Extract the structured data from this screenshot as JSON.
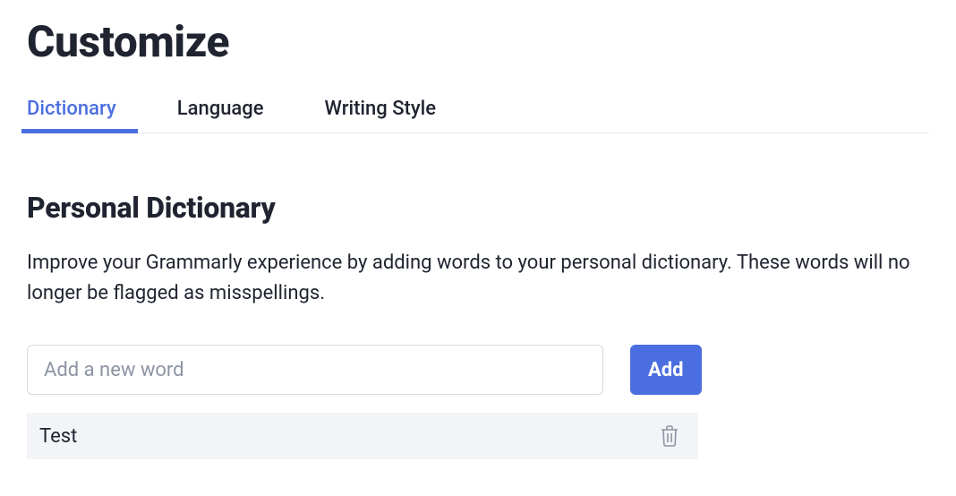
{
  "page": {
    "title": "Customize"
  },
  "tabs": [
    {
      "label": "Dictionary",
      "active": true
    },
    {
      "label": "Language",
      "active": false
    },
    {
      "label": "Writing Style",
      "active": false
    }
  ],
  "section": {
    "title": "Personal Dictionary",
    "description": "Improve your Grammarly experience by adding words to your personal dictionary. These words will no longer be flagged as misspellings."
  },
  "input": {
    "placeholder": "Add a new word",
    "value": ""
  },
  "addButton": {
    "label": "Add"
  },
  "words": [
    {
      "text": "Test"
    }
  ]
}
